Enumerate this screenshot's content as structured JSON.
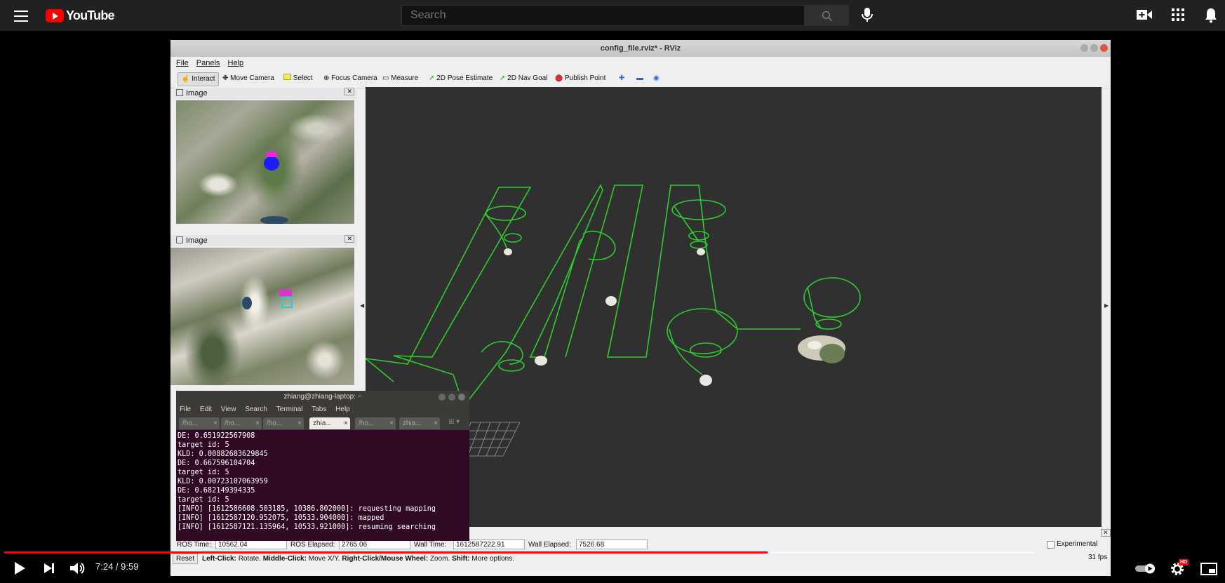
{
  "youtube": {
    "logo_text": "YouTube",
    "search_placeholder": "Search",
    "icons": [
      "menu-icon",
      "youtube-logo",
      "search-icon",
      "microphone-icon",
      "create-video-icon",
      "apps-icon",
      "notifications-icon"
    ]
  },
  "rviz": {
    "window_title": "config_file.rviz* - RViz",
    "menu": [
      "File",
      "Panels",
      "Help"
    ],
    "toolbar": [
      "Interact",
      "Move Camera",
      "Select",
      "Focus Camera",
      "Measure",
      "2D Pose Estimate",
      "2D Nav Goal",
      "Publish Point"
    ],
    "image_panel_1_title": "Image",
    "image_panel_2_title": "Image",
    "status": {
      "ros_time_label": "ROS Time:",
      "ros_time_value": "10562.04",
      "ros_elapsed_label": "ROS Elapsed:",
      "ros_elapsed_value": "2765.06",
      "wall_time_label": "Wall Time:",
      "wall_time_value": "1612587222.91",
      "wall_elapsed_label": "Wall Elapsed:",
      "wall_elapsed_value": "7526.68",
      "experimental_label": "Experimental",
      "reset_label": "Reset",
      "help_left_click": "Left-Click:",
      "help_left_click_desc": "Rotate.",
      "help_middle_click": "Middle-Click:",
      "help_middle_click_desc": "Move X/Y.",
      "help_right_click": "Right-Click/Mouse Wheel:",
      "help_right_click_desc": "Zoom.",
      "help_shift": "Shift:",
      "help_shift_desc": "More options.",
      "fps": "31 fps"
    }
  },
  "terminal": {
    "title": "zhiang@zhiang-laptop: ~",
    "menu": [
      "File",
      "Edit",
      "View",
      "Search",
      "Terminal",
      "Tabs",
      "Help"
    ],
    "tabs": [
      "/ho...",
      "/ho...",
      "/ho...",
      "zhia...",
      "/ho...",
      "zhia..."
    ],
    "lines": [
      "DE: 0.651922567908",
      "target id: 5",
      "KLD: 0.00882683629845",
      "DE: 0.667596104704",
      "target id: 5",
      "KLD: 0.00723107063959",
      "DE: 0.682149394335",
      "target id: 5",
      "[INFO] [1612586608.503185, 10386.802000]: requesting mapping",
      "[INFO] [1612587120.952075, 10533.904000]: mapped",
      "[INFO] [1612587121.135964, 10533.921000]: resuming searching"
    ]
  },
  "player": {
    "time_display": "7:24 / 9:59",
    "progress_fraction": 0.741,
    "icons": [
      "play-icon",
      "next-icon",
      "volume-icon",
      "autoplay-toggle",
      "settings-icon",
      "miniplayer-icon"
    ],
    "hd_badge": "HD",
    "colors": {
      "progress": "#ff0000"
    }
  }
}
